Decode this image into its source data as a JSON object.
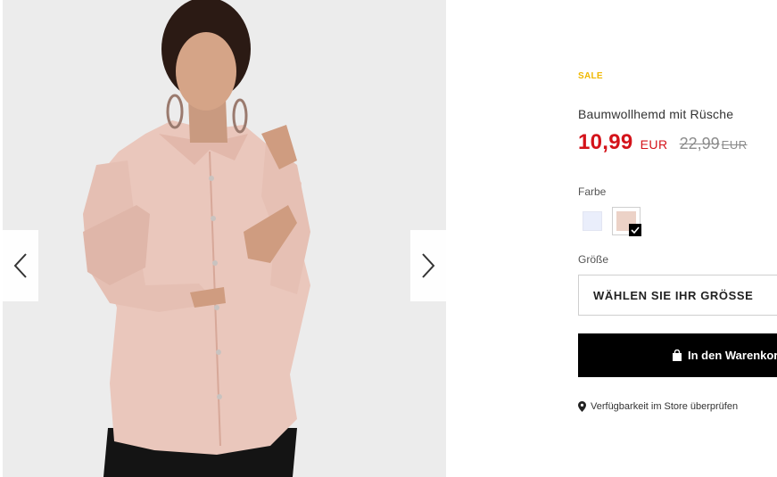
{
  "gallery": {
    "image_alt": "Baumwollhemd mit Rüsche",
    "prev_icon": "chevron-left-icon",
    "next_icon": "chevron-right-icon"
  },
  "product": {
    "sale_tag": "SALE",
    "name": "Baumwollhemd mit Rüsche",
    "price": {
      "current": "10,99",
      "current_unit": "EUR",
      "old": "22,99",
      "old_unit": "EUR"
    },
    "color_label": "Farbe",
    "colors": [
      {
        "name": "light-blue",
        "hex": "#eaeefb",
        "selected": false
      },
      {
        "name": "pink",
        "hex": "#ecd2c7",
        "selected": true
      }
    ],
    "size_label": "Größe",
    "size_select": {
      "value": "WÄHLEN SIE IHR GRÖSSE"
    },
    "cart_button": {
      "label": "In den Warenkorb",
      "icon": "shopping-bag-icon"
    },
    "store_link": {
      "label": "Verfügbarkeit im Store überprüfen",
      "icon": "map-pin-icon"
    }
  },
  "colors": {
    "sale": "#f0b800",
    "price": "#d4131a",
    "old_price": "#8c8c8c",
    "button_bg": "#000000"
  }
}
